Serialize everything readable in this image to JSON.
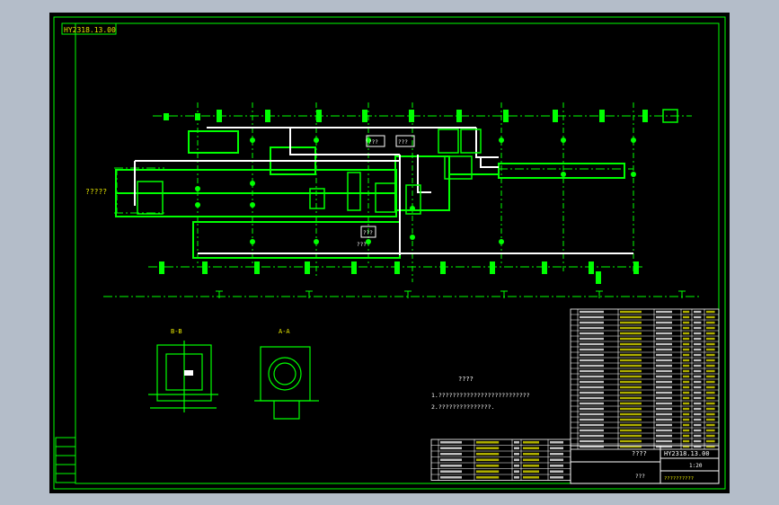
{
  "drawing": {
    "stamp": "HY2318.13.00",
    "left_label": "?????",
    "label_a": "???",
    "label_b": "???",
    "label_c": "???",
    "label_d": "???",
    "notes_title": "????",
    "note_1": "1.??????????????????????????",
    "note_2": "2.???????????????.",
    "section_bb": "B-B",
    "section_aa": "A-A",
    "title_name": "????",
    "title_code": "HY2318.13.00",
    "title_company": "??????????",
    "title_bottom": "???",
    "scale_text": "1:20"
  },
  "colors": {
    "frame": "#00ff00",
    "text": "#e8e800",
    "line": "#ffffff",
    "background": "#000000"
  }
}
